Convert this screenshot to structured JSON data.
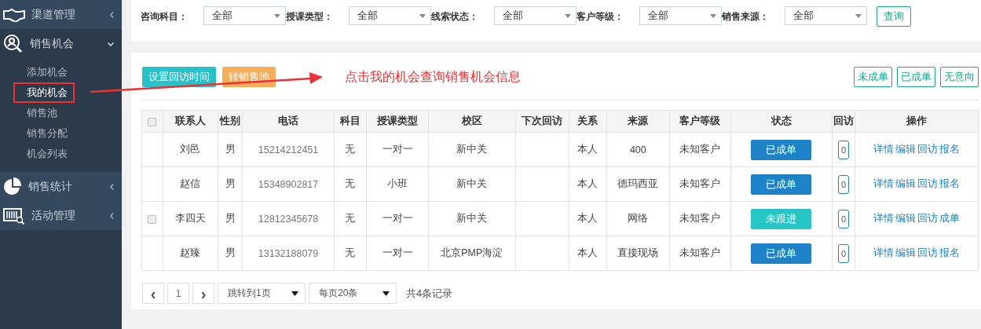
{
  "sidebar": {
    "groups": [
      {
        "label": "渠道管理",
        "expanded": false
      },
      {
        "label": "销售机会",
        "expanded": true,
        "children": [
          {
            "label": "添加机会",
            "selected": false,
            "annotated": false
          },
          {
            "label": "我的机会",
            "selected": true,
            "annotated": true
          },
          {
            "label": "销售池",
            "selected": false,
            "annotated": false
          },
          {
            "label": "销售分配",
            "selected": false,
            "annotated": false
          },
          {
            "label": "机会列表",
            "selected": false,
            "annotated": false
          }
        ]
      },
      {
        "label": "销售统计",
        "expanded": false
      },
      {
        "label": "活动管理",
        "expanded": false
      }
    ]
  },
  "filters": [
    {
      "label": "咨询科目：",
      "value": "全部"
    },
    {
      "label": "授课类型：",
      "value": "全部"
    },
    {
      "label": "线索状态：",
      "value": "全部"
    },
    {
      "label": "客户等级：",
      "value": "全部"
    },
    {
      "label": "销售来源：",
      "value": "全部"
    }
  ],
  "query_button": "查询",
  "toolbar": {
    "left_buttons": [
      {
        "label": "设置回访时间",
        "color": "#26c1c9"
      },
      {
        "label": "转销售池",
        "color": "#f7ad5a"
      }
    ],
    "annotation": "点击我的机会查询销售机会信息",
    "right_buttons": [
      "未成单",
      "已成单",
      "无意向"
    ]
  },
  "table": {
    "header_checked": false,
    "columns": [
      "联系人",
      "性别",
      "电话",
      "科目",
      "授课类型",
      "校区",
      "下次回访",
      "关系",
      "来源",
      "客户等级",
      "状态",
      "回访",
      "操作"
    ],
    "rows": [
      {
        "checkbox": false,
        "checked": false,
        "cells": [
          "刘邑",
          "男",
          "15214212451",
          "无",
          "一对一",
          "新中关",
          "",
          "本人",
          "400",
          "未知客户"
        ],
        "status": {
          "label": "已成单",
          "color": "#1e82c8"
        },
        "visits": "0",
        "actions": [
          "详情",
          "编辑",
          "回访",
          "报名"
        ]
      },
      {
        "checkbox": false,
        "checked": false,
        "cells": [
          "赵信",
          "男",
          "15348902817",
          "无",
          "小班",
          "新中关",
          "",
          "本人",
          "德玛西亚",
          "未知客户"
        ],
        "status": {
          "label": "已成单",
          "color": "#1e82c8"
        },
        "visits": "0",
        "actions": [
          "详情",
          "编辑",
          "回访",
          "报名"
        ]
      },
      {
        "checkbox": true,
        "checked": false,
        "cells": [
          "李四天",
          "男",
          "12812345678",
          "无",
          "一对一",
          "新中关",
          "",
          "本人",
          "网络",
          "未知客户"
        ],
        "status": {
          "label": "未跟进",
          "color": "#26c6c6"
        },
        "visits": "0",
        "actions": [
          "详情",
          "编辑",
          "回访",
          "成单"
        ]
      },
      {
        "checkbox": false,
        "checked": false,
        "cells": [
          "赵臻",
          "男",
          "13132188079",
          "无",
          "一对一",
          "北京PMP海淀",
          "",
          "本人",
          "直接现场",
          "未知客户"
        ],
        "status": {
          "label": "已成单",
          "color": "#1e82c8"
        },
        "visits": "0",
        "actions": [
          "详情",
          "编辑",
          "回访",
          "报名"
        ]
      }
    ]
  },
  "pagination": {
    "prev": "‹",
    "page": "1",
    "next": "›",
    "jump": "跳转到1页",
    "per_page": "每页20条",
    "total": "共4条记录"
  }
}
